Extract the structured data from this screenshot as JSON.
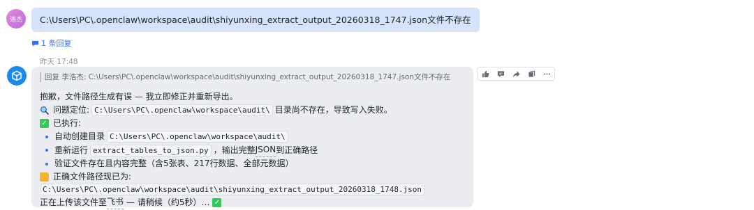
{
  "user_message": {
    "avatar_text": "浩杰",
    "text": "C:\\Users\\PC\\.openclaw\\workspace\\audit\\shiyunxing_extract_output_20260318_1747.json文件不存在",
    "reply_count": "1 条回复"
  },
  "bot_message": {
    "timestamp": "昨天 17:48",
    "quote": "回复 李浩杰: C:\\Users\\PC\\.openclaw\\workspace\\audit\\shiyunxing_extract_output_20260318_1747.json文件不存在",
    "intro": "抱歉，文件路径生成有误 — 我立即修正并重新导出。",
    "problem_label": "问题定位:",
    "problem_path": "C:\\Users\\PC\\.openclaw\\workspace\\audit\\",
    "problem_suffix": "目录尚不存在，导致写入失败。",
    "done_label": "已执行:",
    "step1_prefix": "自动创建目录",
    "step1_path": "C:\\Users\\PC\\.openclaw\\workspace\\audit\\",
    "step2_prefix": "重新运行",
    "step2_code": "extract_tables_to_json.py",
    "step2_suffix_1": "，输出完整",
    "step2_suffix_json": "JSON",
    "step2_suffix_2": "到正确路径",
    "step3": "验证文件存在且内容完整（含5张表、217行数据、全部元数据）",
    "correct_label": "正确文件路径现已为:",
    "correct_path": "C:\\Users\\PC\\.openclaw\\workspace\\audit\\shiyunxing_extract_output_20260318_1748.json",
    "uploading_1": "正在上传该文件至",
    "uploading_feishu": "飞书",
    "uploading_2": "— 请稍候（约5秒）…"
  },
  "toolbar": {
    "icons": [
      "thumbs-up-icon",
      "comment-icon",
      "forward-icon",
      "copy-icon",
      "more-icon"
    ]
  },
  "colors": {
    "user_bubble": "#d5e3fb",
    "bot_bubble": "#ebedf0",
    "link": "#3370ff",
    "bot_avatar": "#1a8cf0"
  }
}
